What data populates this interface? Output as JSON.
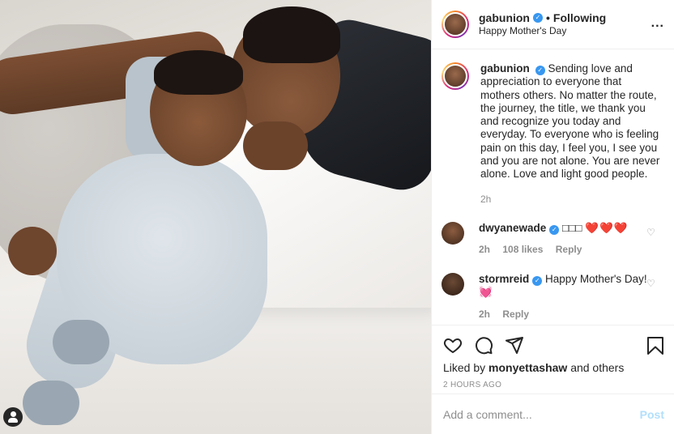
{
  "header": {
    "username": "gabunion",
    "following_label": "Following",
    "location": "Happy Mother's Day",
    "more_label": "..."
  },
  "caption": {
    "username": "gabunion",
    "text": "Sending love and appreciation to everyone that mothers others. No matter the route, the journey, the title, we thank you and recognize you today and everyday. To everyone who is feeling pain on this day, I feel you, I see you and you are not alone. You are never alone. Love and light good people.",
    "time": "2h"
  },
  "comments": [
    {
      "username": "dwyanewade",
      "text": "□□□",
      "hearts": "❤️❤️❤️",
      "time": "2h",
      "likes": "108 likes",
      "reply_label": "Reply"
    },
    {
      "username": "stormreid",
      "text": "Happy Mother's Day!",
      "emoji": "💓",
      "time": "2h",
      "likes": "",
      "reply_label": "Reply"
    }
  ],
  "actions": {
    "liked_by_prefix": "Liked by",
    "liked_by_user": "monyettashaw",
    "liked_by_suffix": "and others",
    "timestamp": "2 HOURS AGO"
  },
  "composer": {
    "placeholder": "Add a comment...",
    "post_label": "Post"
  },
  "colors": {
    "verified": "#3897f0",
    "post_disabled": "#b2dffc",
    "muted": "#8e8e8e"
  }
}
